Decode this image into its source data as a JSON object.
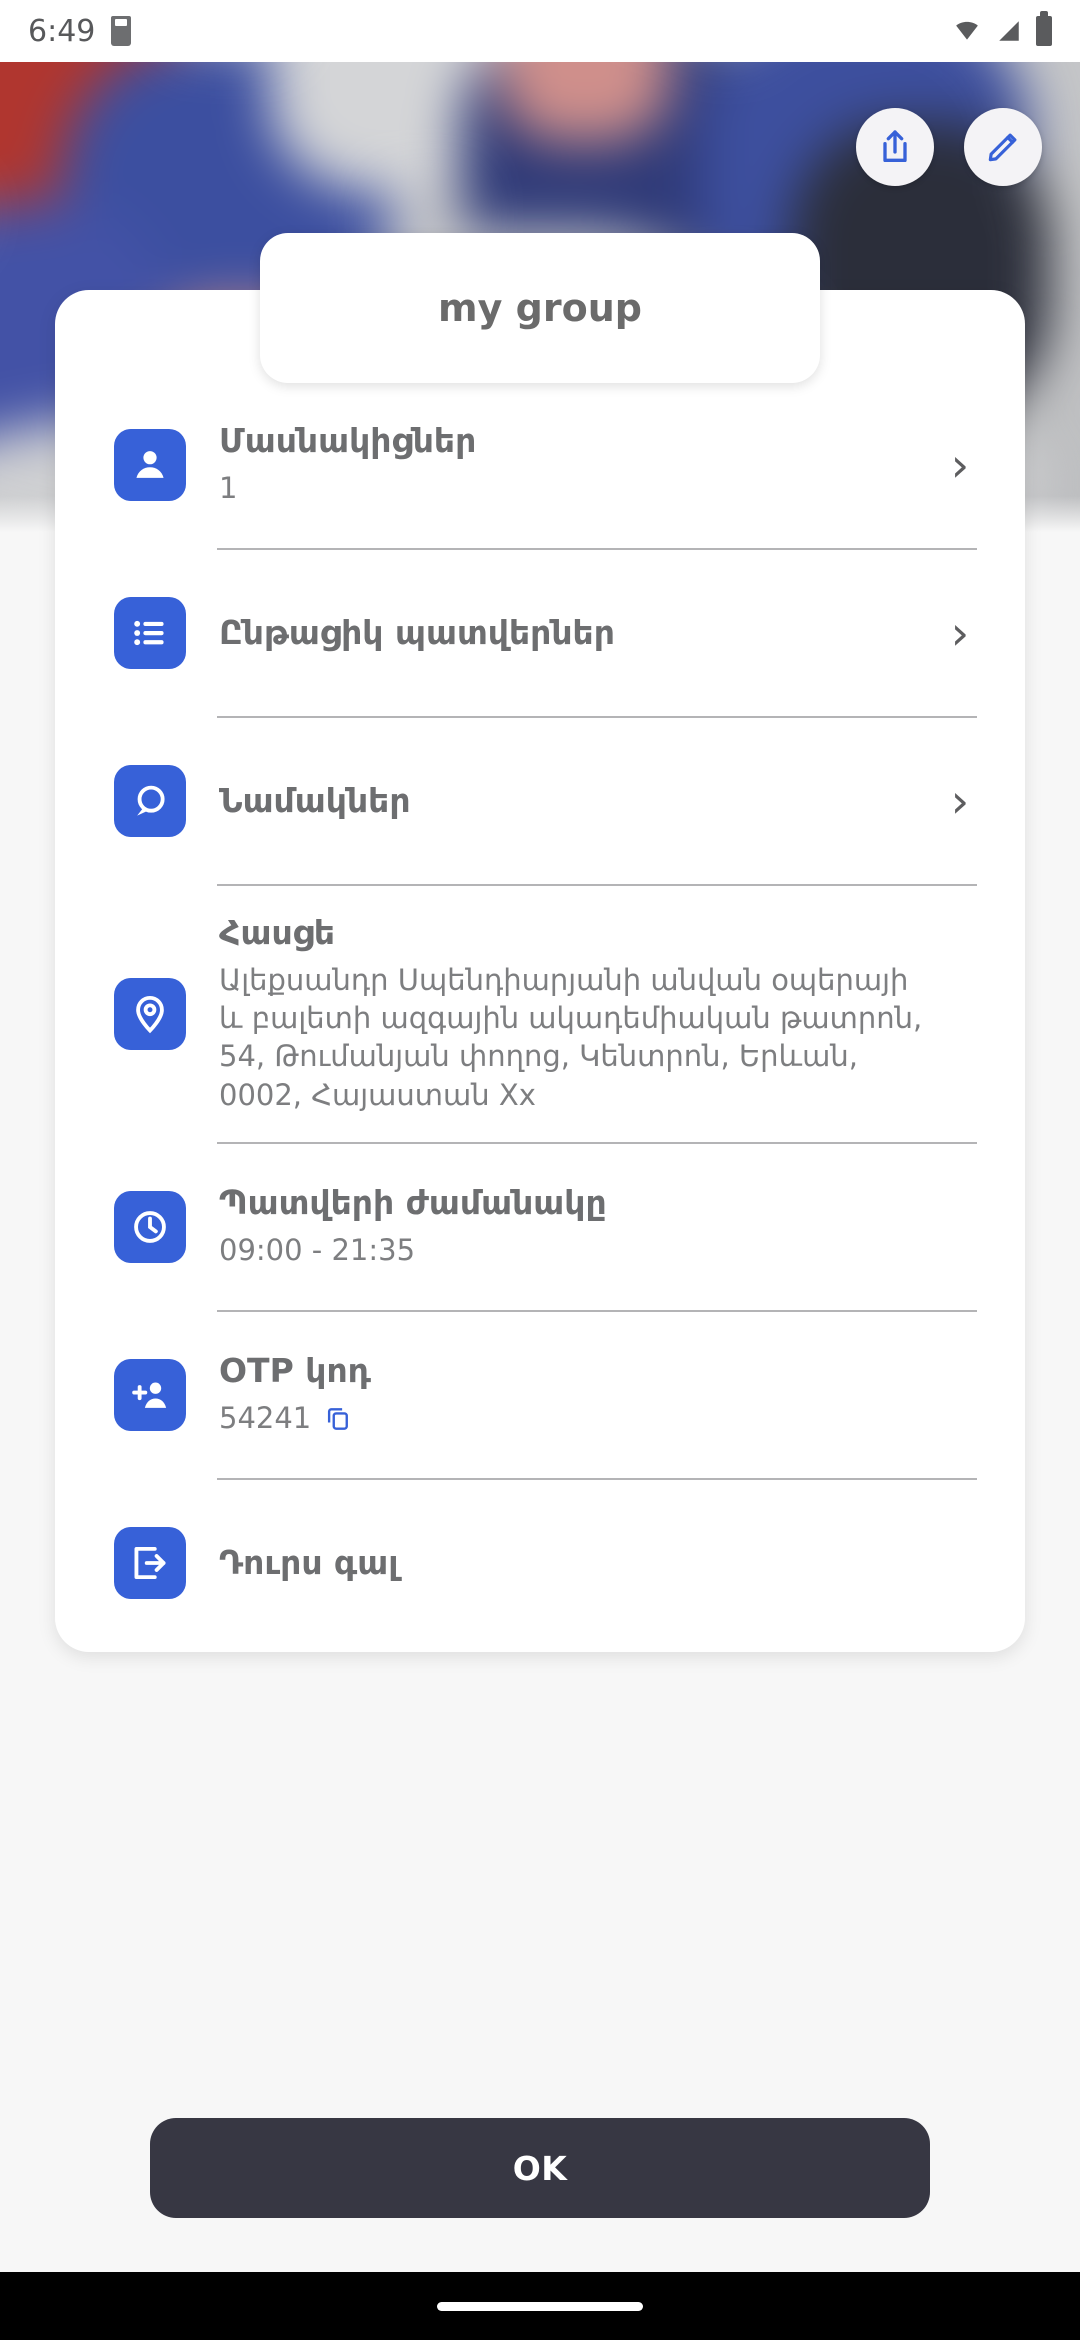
{
  "status_bar": {
    "time": "6:49",
    "icons": [
      "sd-card-icon",
      "wifi-icon",
      "cellular-signal-icon",
      "battery-icon"
    ]
  },
  "header": {
    "share_button": {
      "name": "share-button",
      "icon": "share-icon"
    },
    "edit_button": {
      "name": "edit-button",
      "icon": "pencil-icon"
    }
  },
  "card": {
    "title": "my group"
  },
  "rows": [
    {
      "icon": "person-icon",
      "title": "Մասնակիցներ",
      "subtitle": "1",
      "chevron": "›"
    },
    {
      "icon": "list-icon",
      "title": "Ընթացիկ պատվերներ",
      "subtitle": "",
      "chevron": "›"
    },
    {
      "icon": "chat-bubble-icon",
      "title": "Նամակներ",
      "subtitle": "",
      "chevron": "›"
    },
    {
      "icon": "location-pin-icon",
      "title": "Հասցե",
      "subtitle": "Ալեքսանդր Սպենդիարյանի անվան օպերայի և բալետի ազգային ակադեմիական թատրոն, 54, Թումանյան փողոց, Կենտրոն, Երևան, 0002, Հայաստան   Xx",
      "chevron": ""
    },
    {
      "icon": "clock-icon",
      "title": "Պատվերի ժամանակը",
      "subtitle": "09:00 - 21:35",
      "chevron": ""
    },
    {
      "icon": "add-person-icon",
      "title": "OTP կոդ",
      "subtitle": "54241",
      "copy_icon": "copy-icon",
      "chevron": ""
    },
    {
      "icon": "logout-icon",
      "title": "Դուրս գալ",
      "subtitle": "",
      "chevron": ""
    }
  ],
  "footer": {
    "ok_label": "OK"
  },
  "colors": {
    "accent_blue": "#3761d8",
    "title_grey": "#6d6e70",
    "ok_button_bg": "#373743",
    "card_bg": "#ffffff",
    "page_bg": "#f7f7f7"
  }
}
